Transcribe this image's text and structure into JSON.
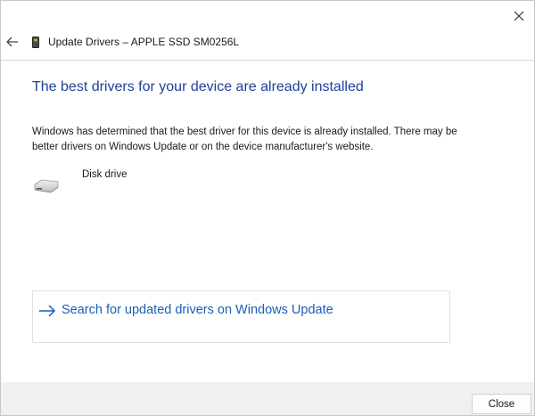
{
  "window": {
    "title": "Update Drivers – APPLE SSD SM0256L",
    "close_glyph": "✕",
    "back_icon": "back-arrow-icon",
    "device_icon": "device-icon"
  },
  "main": {
    "heading": "The best drivers for your device are already installed",
    "description": "Windows has determined that the best driver for this device is already installed. There may be better drivers on Windows Update or on the device manufacturer's website.",
    "device": {
      "label": "Disk drive",
      "icon": "disk-drive-icon"
    },
    "search_link": {
      "label": "Search for updated drivers on Windows Update",
      "icon": "arrow-right-icon"
    }
  },
  "footer": {
    "close_label": "Close"
  },
  "colors": {
    "heading": "#1f3f99",
    "link": "#1a5fb4",
    "footer_bg": "#f0f0f0"
  }
}
